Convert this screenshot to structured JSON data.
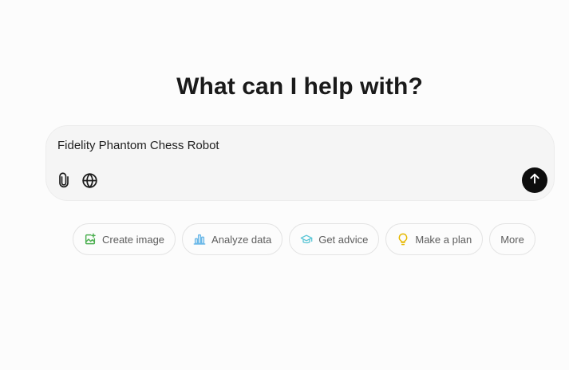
{
  "main": {
    "heading": "What can I help with?"
  },
  "composer": {
    "input_value": "Fidelity Phantom Chess Robot",
    "attach_icon": "paperclip-icon",
    "search_icon": "globe-icon",
    "send_icon": "arrow-up-icon"
  },
  "suggestions": [
    {
      "label": "Create image",
      "icon": "image-icon",
      "color": "#4caf50"
    },
    {
      "label": "Analyze data",
      "icon": "bar-chart-icon",
      "color": "#6bb8e8"
    },
    {
      "label": "Get advice",
      "icon": "graduation-cap-icon",
      "color": "#5cc6d6"
    },
    {
      "label": "Make a plan",
      "icon": "lightbulb-icon",
      "color": "#e6b800"
    },
    {
      "label": "More",
      "icon": "",
      "color": ""
    }
  ]
}
